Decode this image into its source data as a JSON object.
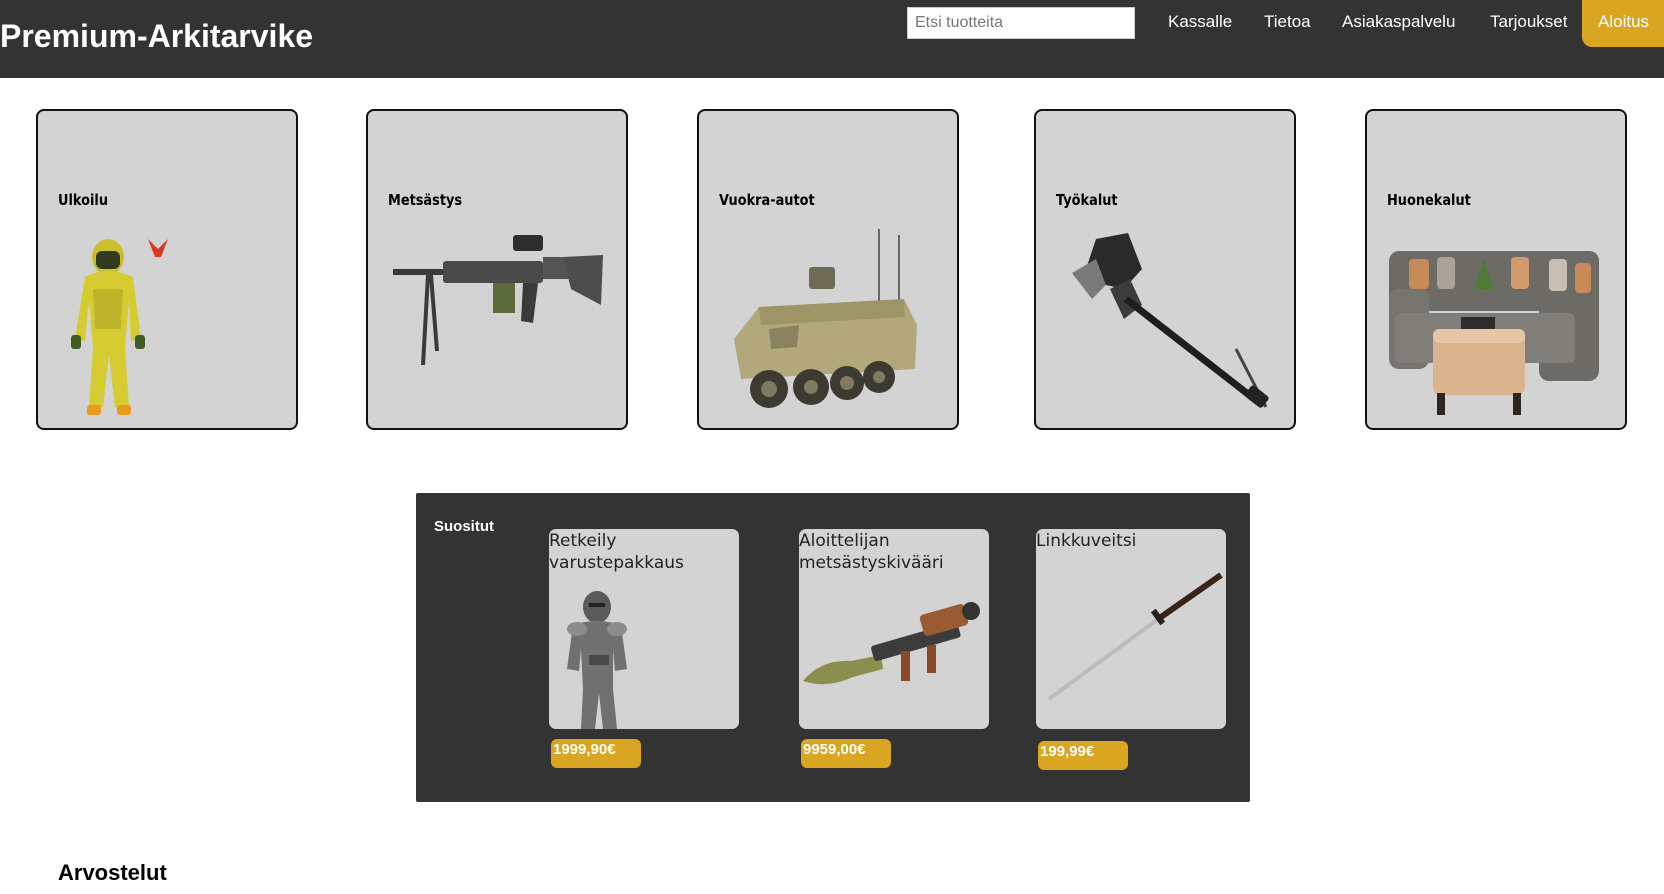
{
  "header": {
    "brand": "Premium-Arkitarvike",
    "search_placeholder": "Etsi tuotteita",
    "nav": [
      "Kassalle",
      "Tietoa",
      "Asiakaspalvelu",
      "Tarjoukset",
      "Aloitus"
    ],
    "active_nav": "Aloitus",
    "colors": {
      "bar": "#333333",
      "accent": "#daa520"
    }
  },
  "categories": [
    {
      "title": "Ulkoilu",
      "image": "hazmat-suit-icon"
    },
    {
      "title": "Metsästys",
      "image": "machine-gun-icon"
    },
    {
      "title": "Vuokra-autot",
      "image": "armored-vehicle-icon"
    },
    {
      "title": "Työkalut",
      "image": "heavy-weapon-icon"
    },
    {
      "title": "Huonekalut",
      "image": "sofa-icon"
    }
  ],
  "popular": {
    "title": "Suositut",
    "products": [
      {
        "name": "Retkeily varustepakkaus",
        "price": "1999,90€",
        "image": "knight-armor-icon"
      },
      {
        "name": "Aloittelijan metsästyskivääri",
        "price": "9959,00€",
        "image": "rocket-launcher-icon"
      },
      {
        "name": "Linkkuveitsi",
        "price": "199,99€",
        "image": "katana-icon"
      }
    ]
  },
  "reviews": {
    "title": "Arvostelut"
  }
}
